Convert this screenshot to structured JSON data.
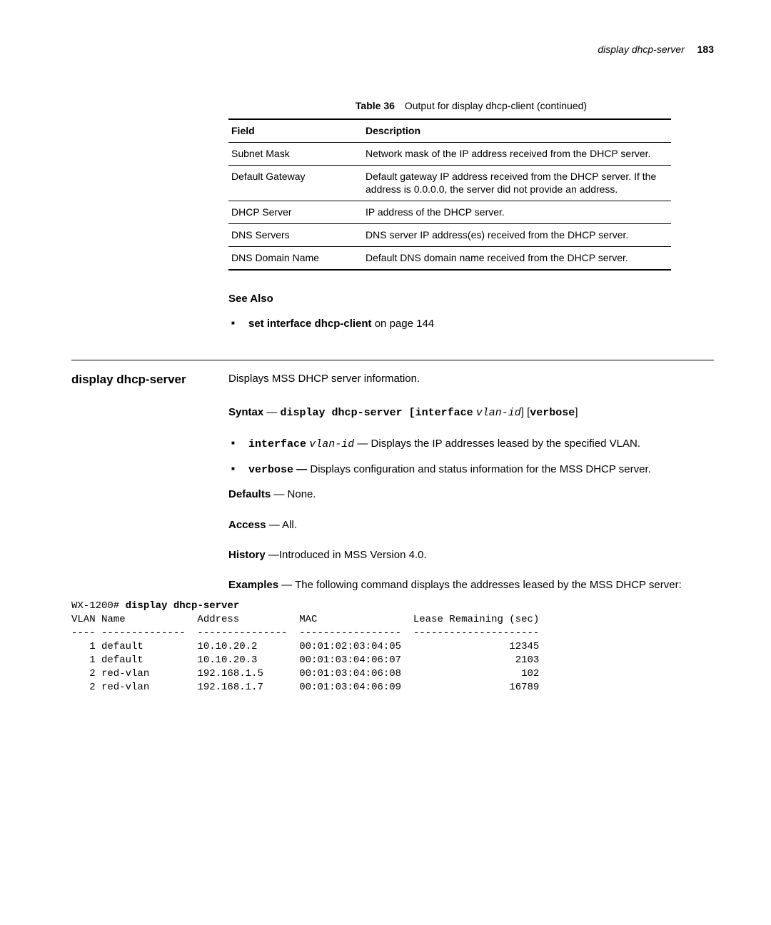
{
  "header": {
    "command": "display dhcp-server",
    "page": "183"
  },
  "table": {
    "caption_num": "Table 36",
    "caption_text": "Output for display dhcp-client (continued)",
    "col_field": "Field",
    "col_desc": "Description",
    "rows": [
      {
        "field": "Subnet Mask",
        "desc": "Network mask of the IP address received from the DHCP server."
      },
      {
        "field": "Default Gateway",
        "desc": "Default gateway IP address received from the DHCP server. If the address is 0.0.0.0, the server did not provide an address."
      },
      {
        "field": "DHCP Server",
        "desc": "IP address of the DHCP server."
      },
      {
        "field": "DNS Servers",
        "desc": "DNS server IP address(es) received from the DHCP server."
      },
      {
        "field": "DNS Domain Name",
        "desc": "Default DNS domain name received from the DHCP server."
      }
    ]
  },
  "see_also": {
    "label": "See Also",
    "item_cmd": "set interface dhcp-client",
    "item_tail": " on page 144"
  },
  "command": {
    "name": "display dhcp-server",
    "summary": "Displays MSS DHCP server information.",
    "syntax_label": "Syntax",
    "syntax_cmd": "display dhcp-server [interface",
    "syntax_var": "vlan-id",
    "syntax_close": "]",
    "syntax_opt_open": "[",
    "syntax_opt": "verbose",
    "syntax_opt_close": "]",
    "opt1_kw": "interface",
    "opt1_var": "vlan-id",
    "opt1_text": " — Displays the IP addresses leased by the specified VLAN.",
    "opt2_kw": "verbose",
    "opt2_dash": " —",
    "opt2_text": " Displays configuration and status information for the MSS DHCP server.",
    "defaults_label": "Defaults",
    "defaults_text": " — None.",
    "access_label": "Access",
    "access_text": " — All.",
    "history_label": "History",
    "history_text": " —Introduced in MSS Version 4.0.",
    "examples_label": "Examples",
    "examples_text": " — The following command displays the addresses leased by the MSS DHCP server:"
  },
  "cli": {
    "prompt": "WX-1200# ",
    "cmd": "display dhcp-server",
    "header": "VLAN Name            Address          MAC                Lease Remaining (sec)",
    "sep": "---- --------------  ---------------  -----------------  ---------------------",
    "rows": [
      "   1 default         10.10.20.2       00:01:02:03:04:05                  12345",
      "   1 default         10.10.20.3       00:01:03:04:06:07                   2103",
      "   2 red-vlan        192.168.1.5      00:01:03:04:06:08                    102",
      "   2 red-vlan        192.168.1.7      00:01:03:04:06:09                  16789"
    ]
  },
  "chart_data": {
    "type": "table",
    "title": "display dhcp-server output",
    "columns": [
      "VLAN",
      "Name",
      "Address",
      "MAC",
      "Lease Remaining (sec)"
    ],
    "rows": [
      [
        1,
        "default",
        "10.10.20.2",
        "00:01:02:03:04:05",
        12345
      ],
      [
        1,
        "default",
        "10.10.20.3",
        "00:01:03:04:06:07",
        2103
      ],
      [
        2,
        "red-vlan",
        "192.168.1.5",
        "00:01:03:04:06:08",
        102
      ],
      [
        2,
        "red-vlan",
        "192.168.1.7",
        "00:01:03:04:06:09",
        16789
      ]
    ]
  }
}
